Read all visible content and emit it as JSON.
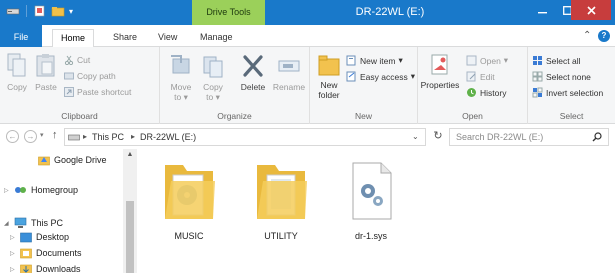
{
  "titlebar": {
    "title": "DR-22WL (E:)",
    "context_tab": "Drive Tools",
    "accent": "#1979ca",
    "context_color": "#9bd05a"
  },
  "ribbon_tabs": [
    "File",
    "Home",
    "Share",
    "View",
    "Manage"
  ],
  "clipboard": {
    "label": "Clipboard",
    "copy": "Copy",
    "paste": "Paste",
    "cut": "Cut",
    "copy_path": "Copy path",
    "paste_shortcut": "Paste shortcut"
  },
  "organize": {
    "label": "Organize",
    "move_to": "Move to",
    "copy_to": "Copy to",
    "delete": "Delete",
    "rename": "Rename"
  },
  "new_group": {
    "label": "New",
    "new_folder": "New folder",
    "new_item": "New item",
    "easy_access": "Easy access"
  },
  "open_group": {
    "label": "Open",
    "properties": "Properties",
    "open": "Open",
    "edit": "Edit",
    "history": "History"
  },
  "select_group": {
    "label": "Select",
    "select_all": "Select all",
    "select_none": "Select none",
    "invert_selection": "Invert selection"
  },
  "address": {
    "crumbs": [
      "This PC",
      "DR-22WL (E:)"
    ],
    "search_placeholder": "Search DR-22WL (E:)"
  },
  "nav": {
    "google_drive": "Google Drive",
    "homegroup": "Homegroup",
    "this_pc": "This PC",
    "desktop": "Desktop",
    "documents": "Documents",
    "downloads": "Downloads"
  },
  "files": [
    {
      "name": "MUSIC",
      "icon": "folder-icon"
    },
    {
      "name": "UTILITY",
      "icon": "folder-icon"
    },
    {
      "name": "dr-1.sys",
      "icon": "system-file-icon"
    }
  ]
}
